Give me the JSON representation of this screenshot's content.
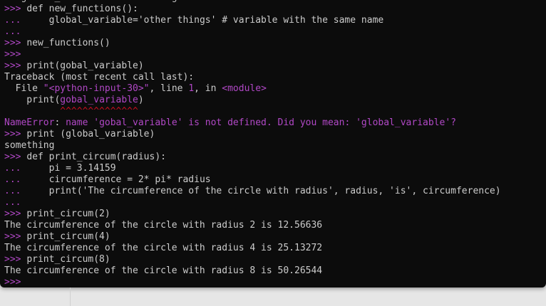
{
  "colors": {
    "terminal_bg": "#0c0c0c",
    "text": "#cccccc",
    "prompt": "#b148c6",
    "error": "#b148c6",
    "carets": "#c50f1f",
    "page_bg": "#e6e6e6"
  },
  "lines": [
    {
      "kind": "partial",
      "parts": [
        {
          "t": "plain",
          "v": "   global_variable = 'something'"
        }
      ]
    },
    {
      "kind": "code",
      "prompt": ">>> ",
      "parts": [
        {
          "t": "plain",
          "v": "def new_functions():"
        }
      ]
    },
    {
      "kind": "code",
      "prompt": "... ",
      "parts": [
        {
          "t": "plain",
          "v": "    global_variable='other things' # variable with the same name"
        }
      ]
    },
    {
      "kind": "code",
      "prompt": "...",
      "parts": []
    },
    {
      "kind": "code",
      "prompt": ">>> ",
      "parts": [
        {
          "t": "plain",
          "v": "new_functions()"
        }
      ]
    },
    {
      "kind": "code",
      "prompt": ">>>",
      "parts": []
    },
    {
      "kind": "code",
      "prompt": ">>> ",
      "parts": [
        {
          "t": "plain",
          "v": "print(gobal_variable)"
        }
      ]
    },
    {
      "kind": "output",
      "parts": [
        {
          "t": "plain",
          "v": "Traceback (most recent call last):"
        }
      ]
    },
    {
      "kind": "output",
      "parts": [
        {
          "t": "plain",
          "v": "  File "
        },
        {
          "t": "string",
          "v": "\"<python-input-30>\""
        },
        {
          "t": "plain",
          "v": ", line "
        },
        {
          "t": "string",
          "v": "1"
        },
        {
          "t": "plain",
          "v": ", in "
        },
        {
          "t": "string",
          "v": "<module>"
        }
      ]
    },
    {
      "kind": "output",
      "parts": [
        {
          "t": "plain",
          "v": "    print("
        },
        {
          "t": "fn",
          "v": "gobal_variable"
        },
        {
          "t": "plain",
          "v": ")"
        }
      ]
    },
    {
      "kind": "output",
      "parts": [
        {
          "t": "carets",
          "v": "          ^^^^^^^^^^^^^^"
        }
      ]
    },
    {
      "kind": "output",
      "parts": [
        {
          "t": "string",
          "v": "NameError"
        },
        {
          "t": "plain",
          "v": ": "
        },
        {
          "t": "string",
          "v": "name 'gobal_variable' is not defined. Did you mean: 'global_variable'?"
        }
      ]
    },
    {
      "kind": "code",
      "prompt": ">>> ",
      "parts": [
        {
          "t": "plain",
          "v": "print (global_variable)"
        }
      ]
    },
    {
      "kind": "output",
      "parts": [
        {
          "t": "plain",
          "v": "something"
        }
      ]
    },
    {
      "kind": "code",
      "prompt": ">>> ",
      "parts": [
        {
          "t": "plain",
          "v": "def print_circum(radius):"
        }
      ]
    },
    {
      "kind": "code",
      "prompt": "... ",
      "parts": [
        {
          "t": "plain",
          "v": "    pi = 3.14159"
        }
      ]
    },
    {
      "kind": "code",
      "prompt": "... ",
      "parts": [
        {
          "t": "plain",
          "v": "    circumference = 2* pi* radius"
        }
      ]
    },
    {
      "kind": "code",
      "prompt": "... ",
      "parts": [
        {
          "t": "plain",
          "v": "    print('The circumference of the circle with radius', radius, 'is', circumference)"
        }
      ]
    },
    {
      "kind": "code",
      "prompt": "...",
      "parts": []
    },
    {
      "kind": "code",
      "prompt": ">>> ",
      "parts": [
        {
          "t": "plain",
          "v": "print_circum(2)"
        }
      ]
    },
    {
      "kind": "output",
      "parts": [
        {
          "t": "plain",
          "v": "The circumference of the circle with radius 2 is 12.56636"
        }
      ]
    },
    {
      "kind": "code",
      "prompt": ">>> ",
      "parts": [
        {
          "t": "plain",
          "v": "print_circum(4)"
        }
      ]
    },
    {
      "kind": "output",
      "parts": [
        {
          "t": "plain",
          "v": "The circumference of the circle with radius 4 is 25.13272"
        }
      ]
    },
    {
      "kind": "code",
      "prompt": ">>> ",
      "parts": [
        {
          "t": "plain",
          "v": "print_circum(8)"
        }
      ]
    },
    {
      "kind": "output",
      "parts": [
        {
          "t": "plain",
          "v": "The circumference of the circle with radius 8 is 50.26544"
        }
      ]
    },
    {
      "kind": "code",
      "prompt": ">>>",
      "parts": []
    }
  ]
}
